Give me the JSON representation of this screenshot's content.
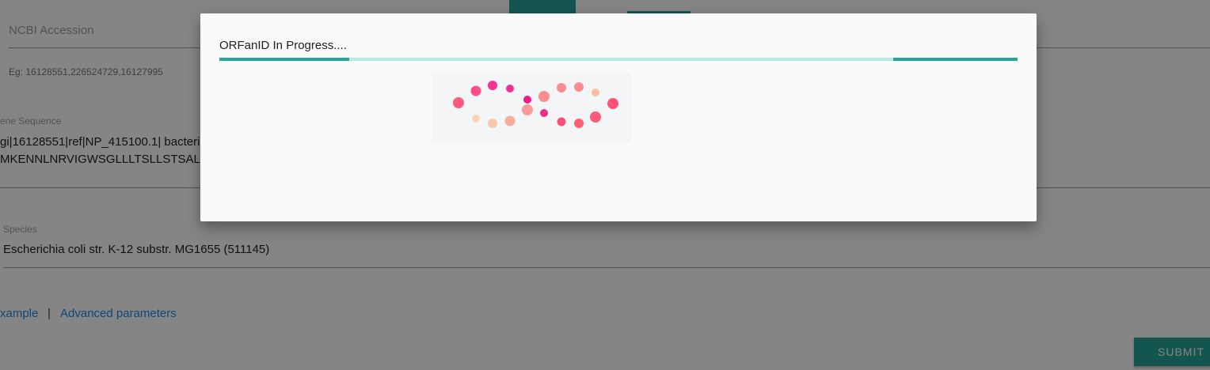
{
  "form": {
    "ncbi_accession": {
      "placeholder": "NCBI Accession",
      "hint": "Eg: 16128551,226524729,16127995"
    },
    "gene_sequence": {
      "label": "ene Sequence",
      "line1": "gi|16128551|ref|NP_415100.1| bacteri",
      "line2": "MKENNLNRVIGWSGLLLTSLLSTSALADN"
    },
    "species": {
      "label": "Species",
      "value": "Escherichia coli str. K-12 substr. MG1655 (511145)"
    },
    "links": {
      "example": "xample",
      "separator": "|",
      "advanced": "Advanced parameters"
    },
    "submit_label": "SUBMIT"
  },
  "modal": {
    "title": "ORFanID In Progress....",
    "progress": {
      "segments": [
        {
          "start": 0.0,
          "end": 0.163
        },
        {
          "start": 0.844,
          "end": 1.0
        }
      ]
    }
  },
  "colors": {
    "accent": "#26a69a",
    "track": "#b2ebe6",
    "link": "#1e88e5"
  }
}
